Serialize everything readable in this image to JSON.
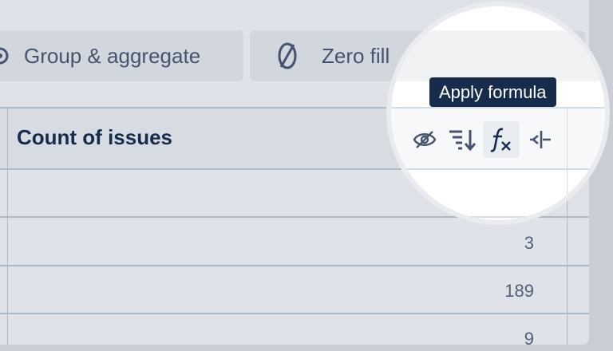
{
  "toolbar": {
    "group_label": "Group & aggregate",
    "zero_label": "Zero fill"
  },
  "table": {
    "column_title": "Count of issues",
    "rows": [
      "",
      "3",
      "189",
      "9"
    ]
  },
  "tooltip": {
    "text": "Apply formula"
  },
  "icons": {
    "group": "gear-icon",
    "zero": "zero-slash-icon",
    "hide": "eye-off-icon",
    "sort": "sort-descending-icon",
    "formula": "function-fx-icon",
    "collapse": "collapse-column-icon"
  },
  "colors": {
    "tooltip_bg": "#172b4d",
    "title_text": "#172b4d",
    "icon": "#44546f"
  }
}
